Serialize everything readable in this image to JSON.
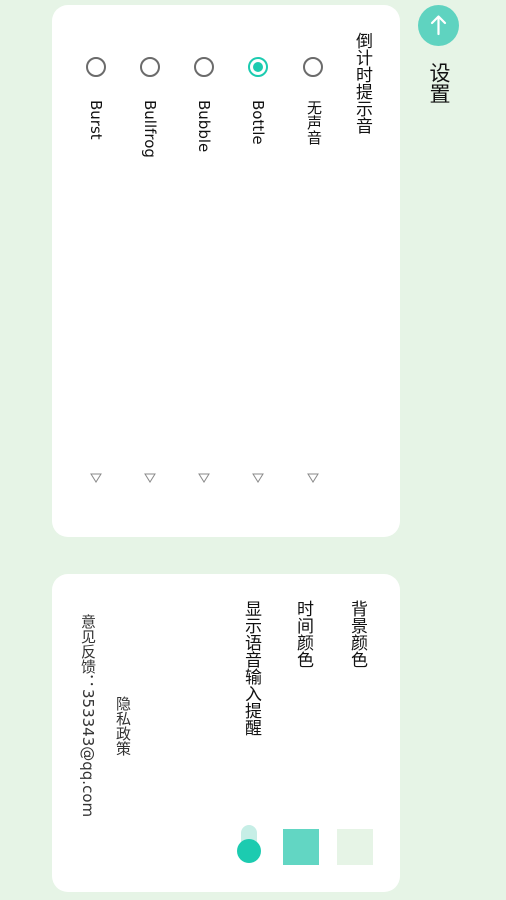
{
  "header": {
    "title": "设置",
    "back_icon": "arrow-up-icon",
    "back_color": "#5fd3c0"
  },
  "sound": {
    "title": "倒计时提示音",
    "options": [
      {
        "label": "无声音",
        "selected": false
      },
      {
        "label": "Bottle",
        "selected": true
      },
      {
        "label": "Bubble",
        "selected": false
      },
      {
        "label": "Bullfrog",
        "selected": false
      },
      {
        "label": "Burst",
        "selected": false
      }
    ],
    "play_icon": "play-icon"
  },
  "settings": {
    "bg_color_label": "背景颜色",
    "bg_color_value": "#e6f4e6",
    "time_color_label": "时间颜色",
    "time_color_value": "#62d6c3",
    "voice_reminder_label": "显示语音输入提醒",
    "voice_reminder_on": true,
    "privacy_label": "隐私政策",
    "feedback_label": "意见反馈：353343@qq.com"
  },
  "colors": {
    "accent": "#1ccbb0"
  }
}
